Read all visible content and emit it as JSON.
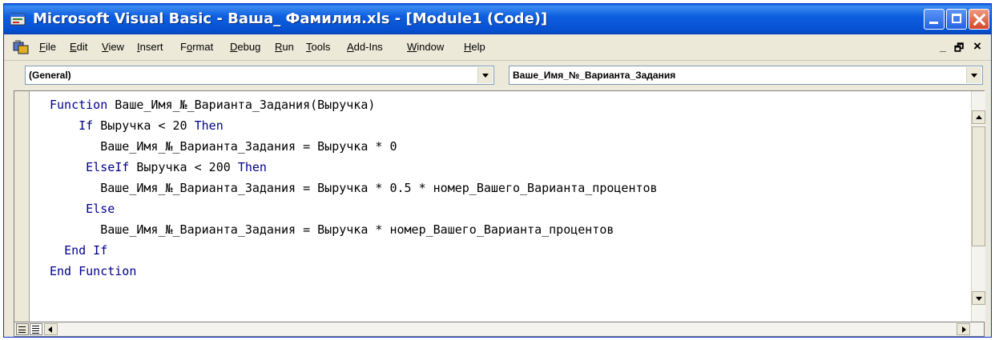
{
  "window": {
    "title": "Microsoft Visual Basic - Ваша_ Фамилия.xls - [Module1 (Code)]"
  },
  "menubar": {
    "items": [
      {
        "accel": "F",
        "rest": "ile"
      },
      {
        "accel": "E",
        "rest": "dit"
      },
      {
        "accel": "V",
        "rest": "iew"
      },
      {
        "accel": "I",
        "rest": "nsert"
      },
      {
        "pre": "F",
        "accel": "o",
        "rest": "rmat"
      },
      {
        "accel": "D",
        "rest": "ebug"
      },
      {
        "accel": "R",
        "rest": "un"
      },
      {
        "accel": "T",
        "rest": "ools"
      },
      {
        "accel": "A",
        "rest": "dd-Ins"
      },
      {
        "accel": "W",
        "rest": "indow"
      },
      {
        "accel": "H",
        "rest": "elp"
      }
    ],
    "mdi_minimize": "_",
    "mdi_restore": "🗗",
    "mdi_close": "×"
  },
  "object_combo": {
    "value": "(General)"
  },
  "procedure_combo": {
    "value": "Ваше_Имя_№_Варианта_Задания"
  },
  "code": {
    "lines": [
      {
        "indent": "",
        "kw1": "Function",
        "text": " Ваше_Имя_№_Варианта_Задания(Выручка)",
        "kw2": ""
      },
      {
        "indent": "    ",
        "kw1": "If",
        "text": " Выручка < 20 ",
        "kw2": "Then"
      },
      {
        "indent": "       ",
        "kw1": "",
        "text": "Ваше_Имя_№_Варианта_Задания = Выручка * 0",
        "kw2": ""
      },
      {
        "indent": "     ",
        "kw1": "ElseIf",
        "text": " Выручка < 200 ",
        "kw2": "Then"
      },
      {
        "indent": "       ",
        "kw1": "",
        "text": "Ваше_Имя_№_Варианта_Задания = Выручка * 0.5 * номер_Вашего_Варианта_процентов",
        "kw2": ""
      },
      {
        "indent": "     ",
        "kw1": "Else",
        "text": "",
        "kw2": ""
      },
      {
        "indent": "       ",
        "kw1": "",
        "text": "Ваше_Имя_№_Варианта_Задания = Выручка * номер_Вашего_Варианта_процентов",
        "kw2": ""
      },
      {
        "indent": "  ",
        "kw1": "End If",
        "text": "",
        "kw2": ""
      },
      {
        "indent": "",
        "kw1": "End Function",
        "text": "",
        "kw2": ""
      }
    ]
  },
  "icons": {
    "app": "vba-app-icon",
    "menu": "vba-menu-icon",
    "procedure_view": "procedure-view-icon",
    "module_view": "full-module-view-icon"
  },
  "colors": {
    "titlebar": "#0a5fd8",
    "keyword": "#00008b",
    "chrome": "#ece9d8",
    "close_button": "#d5462a"
  }
}
